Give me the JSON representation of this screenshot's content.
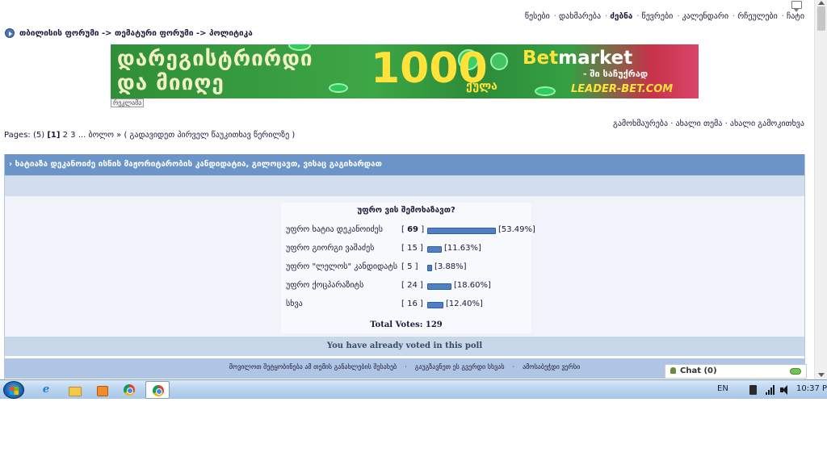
{
  "header": {
    "top_links": [
      {
        "label": "წესები",
        "bold": false
      },
      {
        "label": "დახმარება",
        "bold": false
      },
      {
        "label": "ძებნა",
        "bold": true
      },
      {
        "label": "წევრები",
        "bold": false
      },
      {
        "label": "კალენდარი",
        "bold": false
      },
      {
        "label": "რჩეულები",
        "bold": false
      },
      {
        "label": "ჩატი",
        "bold": false
      }
    ],
    "breadcrumb": "თბილისის ფორუმი -> თემატური ფორუმი -> პოლიტიკა"
  },
  "banner": {
    "left_text_line1": "დარეგისტრირდი",
    "left_text_line2": "და მიიღე",
    "amount": "1000",
    "amount_unit": "ქულა",
    "brand_prefix": "Bet",
    "brand_suffix": "market",
    "tagline": "- ში საჩუქრად",
    "site": "LEADER-BET.COM",
    "label": "რეკლამა"
  },
  "actions": {
    "reply": "გამოხმაურება",
    "new_topic": "ახალი თემა",
    "new_poll": "ახალი გამოკითხვა"
  },
  "pagination": {
    "prefix": "Pages: (5)",
    "current": "[1]",
    "others": "2 3 ...",
    "last": "ბოლო »",
    "goto_first_unread": "( გადავიდეთ პირველ წაუკითხავ წერილზე )"
  },
  "topic": {
    "title": "ხატიაზა დეკანოიძე ისნის მაჟორიტარობის კანდიდატია, გილოცავთ, ვისაც გაგიხარდათ"
  },
  "poll": {
    "question": "უფრო ვის შემოხაზავთ?",
    "options": [
      {
        "label": "უფრო ხატია დეკანოიძეს",
        "count": "69",
        "count_bold": true,
        "percent": "[53.49%]",
        "fraction": 0.5349
      },
      {
        "label": "უფრო გიორგი ვაშაძეს",
        "count": "15",
        "count_bold": false,
        "percent": "[11.63%]",
        "fraction": 0.1163
      },
      {
        "label": "უფრო \"ლელოს\" კანდიდატს",
        "count": "5",
        "count_bold": false,
        "percent": "[3.88%]",
        "fraction": 0.0388
      },
      {
        "label": "უფრო ქოცპარაზიტს",
        "count": "24",
        "count_bold": false,
        "percent": "[18.60%]",
        "fraction": 0.186
      },
      {
        "label": "სხვა",
        "count": "16",
        "count_bold": false,
        "percent": "[12.40%]",
        "fraction": 0.124
      }
    ],
    "total": "Total Votes: 129",
    "already_voted": "You have already voted in this poll",
    "bar_color": "#4f7fc4"
  },
  "bottom_links": {
    "items": [
      "მოვილოთ შეტყობინება ამ თემის განახლების შესახებ",
      "გაუგზავნეთ ეს გვერდი სხვას",
      "ამოსაბეჭდი ვერსი"
    ],
    "separator": "·"
  },
  "chat_widget": {
    "label": "Chat",
    "count": "(0)"
  },
  "taskbar": {
    "lang": "EN",
    "time": "10:37 PM"
  },
  "colors": {
    "header_bar": "#6b95c8",
    "sub_bar": "#d2deee",
    "voted_bar": "#c9d7eb",
    "footer_bar": "#aec5e4"
  }
}
